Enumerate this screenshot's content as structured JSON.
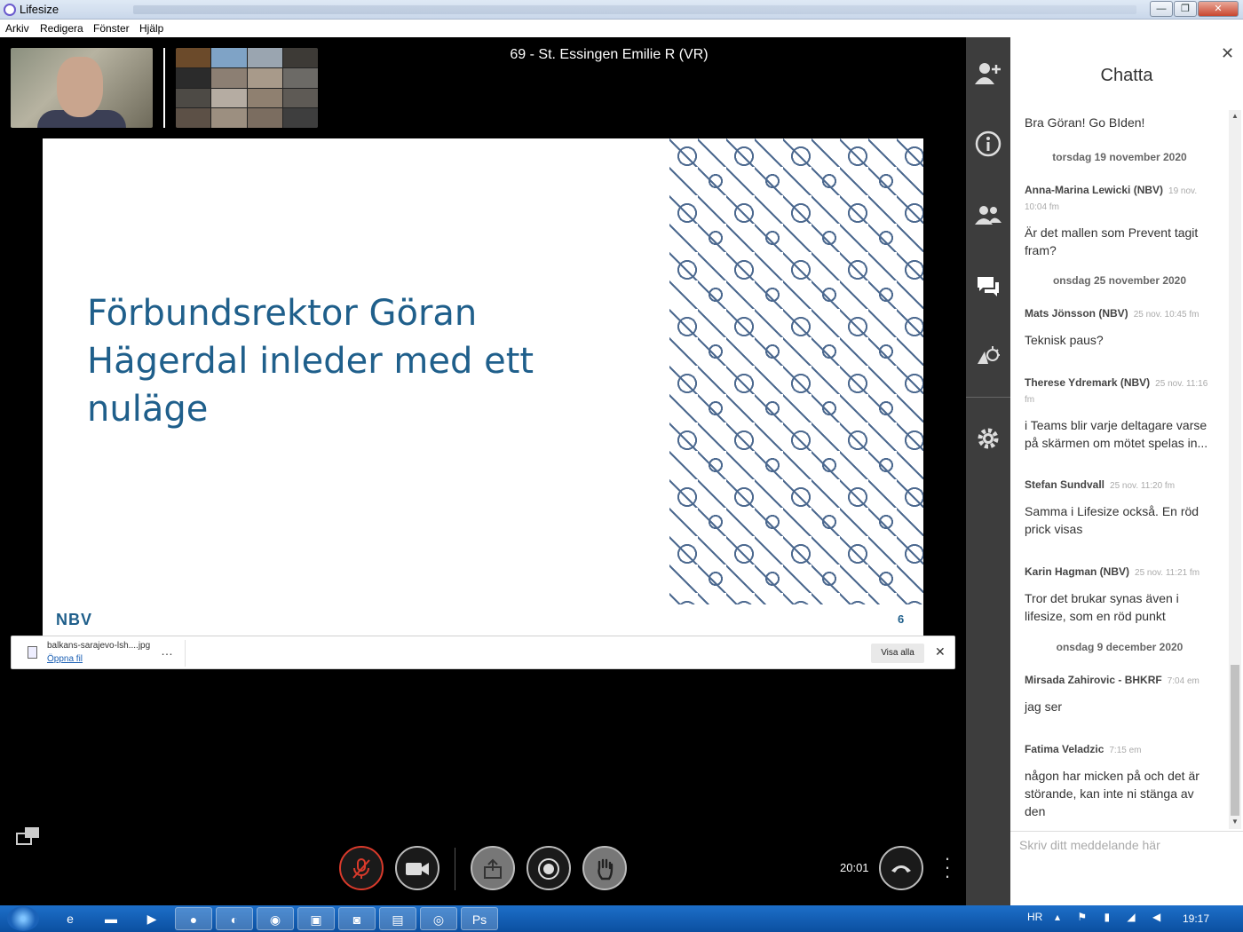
{
  "window": {
    "title": "Lifesize",
    "min": "—",
    "max": "❐",
    "close": "✕"
  },
  "menu": [
    "Arkiv",
    "Redigera",
    "Fönster",
    "Hjälp"
  ],
  "meeting": {
    "title": "69 - St. Essingen Emilie R (VR)",
    "duration": "20:01"
  },
  "slide": {
    "heading": "Förbundsrektor Göran Hägerdal inleder med ett nuläge",
    "logo": "NBV",
    "page_number": "6"
  },
  "download_bar": {
    "filename": "balkans-sarajevo-lsh....jpg",
    "open_label": "Öppna fil",
    "more": "…",
    "show_all": "Visa alla",
    "close": "✕"
  },
  "controls": {
    "mic_icon": "mic-muted-icon",
    "camera_icon": "camera-icon",
    "share_icon": "share-icon",
    "record_icon": "record-icon",
    "hand_icon": "raise-hand-icon",
    "hangup_icon": "hang-up-icon"
  },
  "chat": {
    "title": "Chatta",
    "close": "✕",
    "first_message": "Bra Göran! Go BIden!",
    "date1": "torsdag 19 november 2020",
    "date2": "onsdag 25 november 2020",
    "date3": "onsdag 9 december 2020",
    "messages": [
      {
        "author": "Anna-Marina Lewicki (NBV)",
        "time": "19 nov. 10:04 fm",
        "body": "Är det mallen som Prevent tagit fram?"
      },
      {
        "author": "Mats Jönsson (NBV)",
        "time": "25 nov. 10:45 fm",
        "body": "Teknisk paus?"
      },
      {
        "author": "Therese Ydremark (NBV)",
        "time": "25 nov. 11:16 fm",
        "body": "i Teams blir varje deltagare varse på skärmen om mötet spelas in..."
      },
      {
        "author": "Stefan Sundvall",
        "time": "25 nov. 11:20 fm",
        "body": "Samma i Lifesize också. En röd prick visas"
      },
      {
        "author": "Karin Hagman (NBV)",
        "time": "25 nov. 11:21 fm",
        "body": "Tror det brukar synas även i lifesize, som en röd punkt"
      },
      {
        "author": "Mirsada Zahirovic - BHKRF",
        "time": "7:04 em",
        "body": "jag ser"
      },
      {
        "author": "Fatima Veladzic",
        "time": "7:15 em",
        "body": "någon har micken på och det är störande, kan inte ni stänga av den"
      }
    ],
    "input_placeholder": "Skriv ditt meddelande här"
  },
  "taskbar": {
    "language": "HR",
    "clock": "19:17",
    "apps": [
      "ie-icon",
      "folder-icon",
      "media-player-icon",
      "firefox-icon",
      "edge-icon",
      "chrome-icon",
      "save-icon",
      "outlook-icon",
      "notepad-icon",
      "lifesize-icon",
      "photoshop-icon"
    ]
  }
}
